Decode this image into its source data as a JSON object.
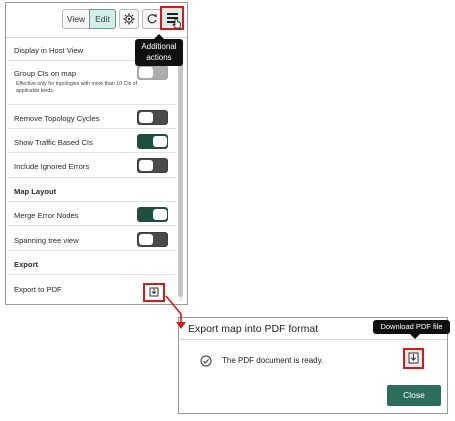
{
  "toolbar": {
    "view_label": "View",
    "edit_label": "Edit",
    "gear_icon": "gear-icon",
    "refresh_icon": "refresh-icon",
    "menu_icon": "hamburger-menu-icon"
  },
  "tooltips": {
    "additional_actions": [
      "Additional",
      "actions"
    ],
    "download_pdf": "Download PDF file"
  },
  "settings": {
    "display_in_host_view": "Display in Host View",
    "group_cis_on_map": "Group CIs on map",
    "group_cis_note": "Effective only for topologies with more than 10 CIs of applicable kinds.",
    "remove_topology_cycles": "Remove Topology Cycles",
    "show_traffic_based_cis": "Show Traffic Based CIs",
    "include_ignored_errors": "Include Ignored Errors",
    "map_layout_section": "Map Layout",
    "merge_error_nodes": "Merge Error Nodes",
    "spanning_tree_view": "Spanning tree view",
    "export_section": "Export",
    "export_to_pdf": "Export to PDF"
  },
  "toggle_states": {
    "group_cis_on_map": "off",
    "remove_topology_cycles": "off",
    "show_traffic_based_cis": "on",
    "include_ignored_errors": "off",
    "merge_error_nodes": "on",
    "spanning_tree_view": "off"
  },
  "dialog": {
    "title": "Export map into PDF format",
    "message": "The PDF document is ready.",
    "close_label": "Close",
    "status_icon": "check-circle-icon",
    "download_icon": "download-icon"
  },
  "colors": {
    "highlight": "#d41b1b",
    "toggle_on": "#1f4d3f",
    "primary_button": "#2c6e5d",
    "tooltip_bg": "#101010"
  }
}
